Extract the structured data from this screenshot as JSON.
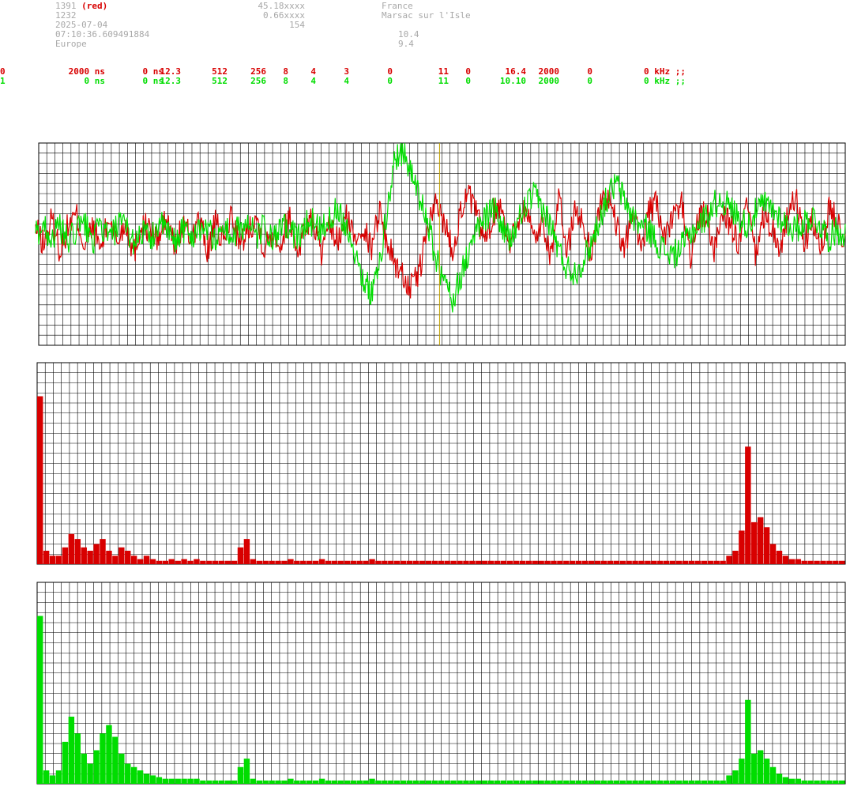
{
  "header": {
    "station_id": "1391",
    "station_tag": "(red)",
    "line2": "1232",
    "date": "2025-07-04",
    "time": "07:10:36.609491884",
    "region": "Europe",
    "lat": "45.18xxxx",
    "lon": "0.66xxxx",
    "alt": "154",
    "country": "France",
    "place": "Marsac sur l'Isle",
    "val1": "10.4",
    "val2": "9.4"
  },
  "channels": [
    {
      "id": "0",
      "color": "#d80000",
      "cells": [
        "2000 ns",
        "0 ns",
        "12.3",
        "512",
        "256",
        "8",
        "4",
        "3",
        "0",
        "11",
        "0",
        "16.4",
        "2000",
        "0",
        "0 kHz ;;"
      ]
    },
    {
      "id": "1",
      "color": "#00dd00",
      "cells": [
        "0 ns",
        "0 ns",
        "12.3",
        "512",
        "256",
        "8",
        "4",
        "4",
        "0",
        "11",
        "0",
        "10.10",
        "2000",
        "0",
        "0 kHz ;;"
      ]
    }
  ],
  "chart_data": [
    {
      "type": "line",
      "name": "waveform",
      "cursor_fraction": 0.497,
      "series": [
        {
          "color": "#d80000",
          "envelope": "noise with negative dip near center",
          "samples": [
            0.05,
            -0.12,
            0.18,
            -0.2,
            0.1,
            0.22,
            -0.15,
            0.08,
            -0.18,
            0.2,
            -0.1,
            0.15,
            -0.22,
            0.12,
            0.05,
            -0.08,
            0.2,
            -0.16,
            0.1,
            -0.05,
            0.18,
            -0.2,
            0.12,
            -0.1,
            0.25,
            -0.15,
            0.08,
            0.2,
            -0.18,
            0.05,
            -0.12,
            0.22,
            -0.2,
            0.1,
            0.15,
            -0.25,
            0.08,
            -0.1,
            0.2,
            -0.05,
            0.12,
            -0.18,
            0.3,
            -0.1,
            -0.35,
            -0.5,
            -0.65,
            -0.4,
            0.1,
            0.35,
            0.15,
            -0.2,
            0.3,
            0.45,
            0.2,
            -0.1,
            0.25,
            0.35,
            -0.15,
            0.2,
            0.3,
            -0.05,
            0.15,
            -0.25,
            0.4,
            -0.2,
            0.3,
            0.1,
            -0.25,
            0.35,
            0.45,
            0.1,
            -0.2,
            0.3,
            -0.15,
            0.25,
            0.35,
            -0.1,
            0.2,
            0.4,
            -0.3,
            0.15,
            0.25,
            -0.2,
            0.3,
            0.1,
            -0.15,
            0.35,
            -0.25,
            0.2,
            0.1,
            -0.2,
            0.25,
            0.4,
            -0.1,
            0.15,
            -0.25,
            0.3,
            0.2,
            -0.1
          ]
        },
        {
          "color": "#00dd00",
          "envelope": "noise with large oscillation near center",
          "samples": [
            0.0,
            0.1,
            -0.05,
            0.08,
            -0.1,
            0.05,
            0.12,
            -0.08,
            0.1,
            -0.05,
            0.08,
            0.1,
            -0.1,
            0.05,
            -0.08,
            0.12,
            0.05,
            -0.1,
            0.08,
            -0.05,
            0.1,
            0.05,
            -0.08,
            0.1,
            -0.05,
            0.08,
            0.12,
            -0.05,
            0.1,
            -0.1,
            0.05,
            0.08,
            -0.05,
            0.1,
            0.15,
            0.05,
            0.2,
            0.3,
            0.1,
            -0.2,
            -0.5,
            -0.7,
            -0.4,
            0.3,
            0.9,
            1.0,
            0.7,
            0.4,
            0.1,
            -0.3,
            -0.6,
            -0.75,
            -0.5,
            -0.2,
            0.05,
            0.2,
            0.3,
            0.1,
            -0.1,
            0.15,
            0.35,
            0.45,
            0.3,
            0.1,
            -0.2,
            -0.4,
            -0.45,
            -0.3,
            -0.1,
            0.2,
            0.45,
            0.6,
            0.4,
            0.2,
            0.1,
            0.05,
            -0.1,
            -0.2,
            -0.25,
            -0.15,
            0.0,
            0.1,
            0.2,
            0.35,
            0.4,
            0.3,
            0.2,
            0.1,
            0.25,
            0.35,
            0.3,
            0.2,
            0.1,
            0.05,
            0.15,
            0.2,
            0.1,
            -0.05,
            0.05,
            0.0
          ]
        }
      ]
    },
    {
      "type": "bar",
      "name": "spectrum-red",
      "color": "#d80000",
      "values": [
        100,
        8,
        5,
        5,
        10,
        18,
        15,
        10,
        8,
        12,
        15,
        8,
        5,
        10,
        8,
        5,
        3,
        5,
        3,
        2,
        2,
        3,
        2,
        3,
        2,
        3,
        2,
        2,
        2,
        2,
        2,
        2,
        10,
        15,
        3,
        2,
        2,
        2,
        2,
        2,
        3,
        2,
        2,
        2,
        2,
        3,
        2,
        2,
        2,
        2,
        2,
        2,
        2,
        3,
        2,
        2,
        2,
        2,
        2,
        2,
        2,
        2,
        2,
        2,
        2,
        2,
        2,
        2,
        2,
        2,
        2,
        2,
        2,
        2,
        2,
        2,
        2,
        2,
        2,
        2,
        2,
        2,
        2,
        2,
        2,
        2,
        2,
        2,
        2,
        2,
        2,
        2,
        2,
        2,
        2,
        2,
        2,
        2,
        2,
        2,
        2,
        2,
        2,
        2,
        2,
        2,
        2,
        2,
        2,
        2,
        5,
        8,
        20,
        70,
        25,
        28,
        22,
        12,
        8,
        5,
        3,
        3,
        2,
        2,
        2,
        2,
        2,
        2,
        2
      ],
      "ylim": [
        0,
        120
      ]
    },
    {
      "type": "bar",
      "name": "spectrum-green",
      "color": "#00dd00",
      "values": [
        100,
        8,
        5,
        8,
        25,
        40,
        30,
        18,
        12,
        20,
        30,
        35,
        28,
        18,
        12,
        10,
        8,
        6,
        5,
        4,
        3,
        3,
        3,
        3,
        3,
        3,
        2,
        2,
        2,
        2,
        2,
        2,
        10,
        15,
        3,
        2,
        2,
        2,
        2,
        2,
        3,
        2,
        2,
        2,
        2,
        3,
        2,
        2,
        2,
        2,
        2,
        2,
        2,
        3,
        2,
        2,
        2,
        2,
        2,
        2,
        2,
        2,
        2,
        2,
        2,
        2,
        2,
        2,
        2,
        2,
        2,
        2,
        2,
        2,
        2,
        2,
        2,
        2,
        2,
        2,
        2,
        2,
        2,
        2,
        2,
        2,
        2,
        2,
        2,
        2,
        2,
        2,
        2,
        2,
        2,
        2,
        2,
        2,
        2,
        2,
        2,
        2,
        2,
        2,
        2,
        2,
        2,
        2,
        2,
        2,
        5,
        8,
        15,
        50,
        18,
        20,
        15,
        10,
        6,
        4,
        3,
        3,
        2,
        2,
        2,
        2,
        2,
        2,
        2
      ],
      "ylim": [
        0,
        120
      ]
    }
  ]
}
